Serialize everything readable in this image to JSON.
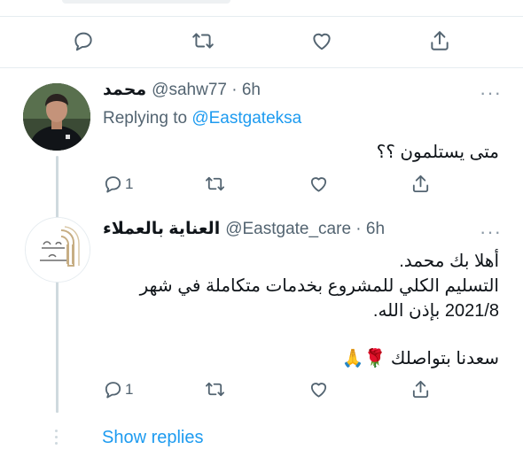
{
  "top_actions": {
    "reply_icon": "reply-icon",
    "retweet_icon": "retweet-icon",
    "like_icon": "like-icon",
    "share_icon": "share-icon"
  },
  "tweet1": {
    "display_name": "محمد",
    "handle": "@sahw77 · 6h",
    "replying_prefix": "Replying to ",
    "replying_handle": "@Eastgateksa",
    "text": "متى يستلمون ؟؟",
    "reply_count": "1"
  },
  "tweet2": {
    "display_name": "العناية بالعملاء",
    "handle": "@Eastgate_care · 6h",
    "line1": "أهلا بك محمد.",
    "line2": "التسليم الكلي للمشروع بخدمات متكاملة في شهر",
    "line3": "2021/8 بإذن الله.",
    "line4": "سعدنا بتواصلك 🌹🙏",
    "reply_count": "1",
    "avatar_logo_text": "بوابة الشرق"
  },
  "show_replies": "Show replies",
  "more_label": "···",
  "colors": {
    "accent": "#1d9bf0",
    "secondary_text": "#536471",
    "divider": "#e6ecf0",
    "thread_line": "#cfd9de"
  }
}
